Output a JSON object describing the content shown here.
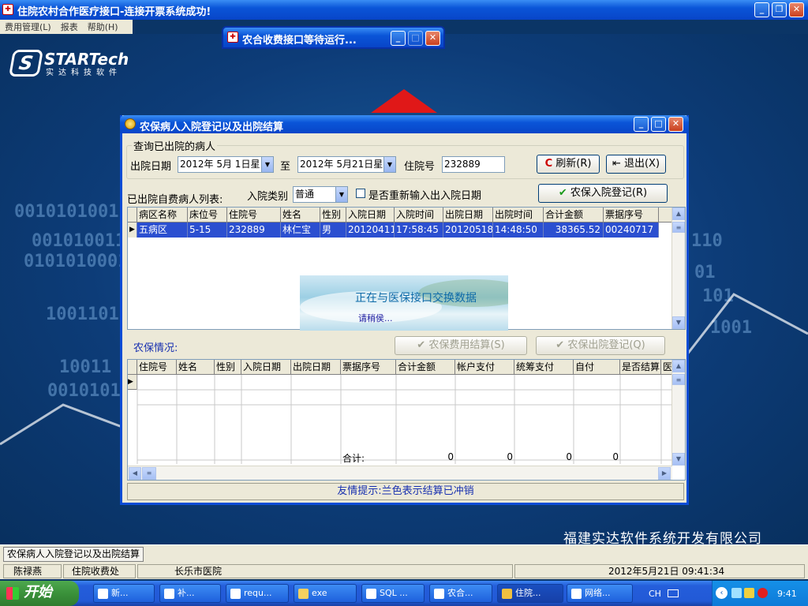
{
  "main_window": {
    "title": "住院农村合作医疗接口-连接开票系统成功!",
    "icon": "app-icon"
  },
  "menu": [
    "费用管理(L)",
    "报表",
    "帮助(H)"
  ],
  "background": {
    "binary": [
      "0010101001",
      "0010100110",
      "0101010001",
      "1001101",
      "10011",
      "0010101",
      "110",
      "101",
      "01",
      "1001"
    ],
    "logo_brand": "STARTech",
    "logo_sub": "实达科技软件",
    "company": "福建实达软件系统开发有限公司"
  },
  "wait_window": {
    "title": "农合收费接口等待运行..."
  },
  "dialog": {
    "title": "农保病人入院登记以及出院结算",
    "query_group": "查询已出院的病人",
    "discharge_date_label": "出院日期",
    "date_from": "2012年 5月 1日星",
    "to_label": "至",
    "date_to": "2012年 5月21日星",
    "admission_no_label": "住院号",
    "admission_no": "232889",
    "refresh_button": "刷新(R)",
    "exit_button": "退出(X)",
    "list_label": "已出院自费病人列表:",
    "admission_type_label": "入院类别",
    "admission_type": "普通",
    "reenter_checkbox": "是否重新输入出入院日期",
    "register_button": "农保入院登记(R)",
    "upper_columns": [
      "病区名称",
      "床位号",
      "住院号",
      "姓名",
      "性别",
      "入院日期",
      "入院时间",
      "出院日期",
      "出院时间",
      "合计金额",
      "票据序号"
    ],
    "upper_rows": [
      [
        "五病区",
        "5-15",
        "232889",
        "林仁宝",
        "男",
        "20120411",
        "17:58:45",
        "20120518",
        "14:48:50",
        "38365.52",
        "00240717"
      ]
    ],
    "progress_msg": "正在与医保接口交换数据",
    "progress_sub": "请稍侯...",
    "insurance_label": "农保情况:",
    "settle_button": "农保费用结算(S)",
    "discharge_button": "农保出院登记(Q)",
    "lower_columns": [
      "住院号",
      "姓名",
      "性别",
      "入院日期",
      "出院日期",
      "票据序号",
      "合计金额",
      "帐户支付",
      "统筹支付",
      "自付",
      "是否结算",
      "医"
    ],
    "total_label": "合计:",
    "totals": [
      "0",
      "0",
      "0",
      "0"
    ],
    "tip": "友情提示:兰色表示结算已冲销"
  },
  "mdi_tab": "农保病人入院登记以及出院结算",
  "status": {
    "user": "陈禄燕",
    "dept": "住院收费处",
    "hospital": "长乐市医院",
    "datetime": "2012年5月21日 09:41:34"
  },
  "taskbar": {
    "start": "开始",
    "tasks": [
      "新...",
      "补...",
      "requ...",
      "exe",
      "SQL ...",
      "农合...",
      "住院...",
      "网络..."
    ],
    "ime": "CH",
    "clock": "9:41"
  }
}
